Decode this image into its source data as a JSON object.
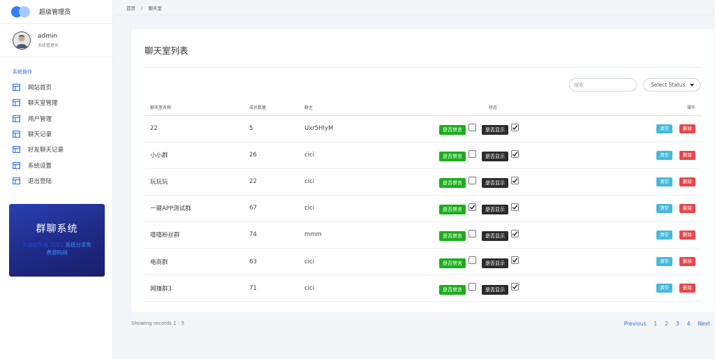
{
  "brand": {
    "name": "超级管理员",
    "accent": "#2f80ff"
  },
  "user": {
    "name": "admin",
    "role": "系统管理员",
    "avatar_icon": "user-avatar"
  },
  "nav": {
    "section": "系统操作",
    "items": [
      {
        "label": "网站首页",
        "icon": "layout-icon"
      },
      {
        "label": "聊天室管理",
        "icon": "layout-icon"
      },
      {
        "label": "用户管理",
        "icon": "layout-icon"
      },
      {
        "label": "聊天记录",
        "icon": "layout-icon"
      },
      {
        "label": "好友聊天记录",
        "icon": "layout-icon"
      },
      {
        "label": "系统设置",
        "icon": "layout-icon"
      },
      {
        "label": "退出登陆",
        "icon": "layout-icon"
      }
    ]
  },
  "promo": {
    "title": "群聊系统",
    "copyright": "©版权所有 2021 ",
    "link": "系统分享免费源码网"
  },
  "breadcrumb": {
    "home": "首页",
    "sep": "/",
    "current": "聊天室"
  },
  "card": {
    "title": "聊天室列表",
    "search_placeholder": "搜索",
    "status_select": "Select Status"
  },
  "table": {
    "headers": {
      "name": "聊天室名称",
      "members": "成员数量",
      "owner": "群主",
      "status": "状态",
      "actions": "操作"
    },
    "mute_label": "是否禁言",
    "show_label": "是否显示",
    "clear_label": "清空",
    "delete_label": "删除",
    "rows": [
      {
        "name": "22",
        "members": "5",
        "owner": "Uxr5HlyM",
        "muted": false,
        "shown": true
      },
      {
        "name": "小小群",
        "members": "26",
        "owner": "cici",
        "muted": false,
        "shown": true
      },
      {
        "name": "玩玩玩",
        "members": "22",
        "owner": "cici",
        "muted": false,
        "shown": true
      },
      {
        "name": "一键APP测试群",
        "members": "67",
        "owner": "cici",
        "muted": true,
        "shown": true
      },
      {
        "name": "嘻嘻粉丝群",
        "members": "74",
        "owner": "mmm",
        "muted": false,
        "shown": true
      },
      {
        "name": "电商群",
        "members": "63",
        "owner": "cici",
        "muted": false,
        "shown": true
      },
      {
        "name": "网赚群3",
        "members": "71",
        "owner": "cici",
        "muted": false,
        "shown": true
      }
    ]
  },
  "footer": {
    "records": "Showing records 1 - 5",
    "pager": [
      "Previous",
      "1",
      "2",
      "3",
      "4",
      "Next"
    ]
  },
  "colors": {
    "mute_tag": "#1aaf1a",
    "show_tag": "#2b2b2b",
    "clear_btn": "#45b9da",
    "delete_btn": "#e5484d",
    "link": "#2f6fe0"
  }
}
